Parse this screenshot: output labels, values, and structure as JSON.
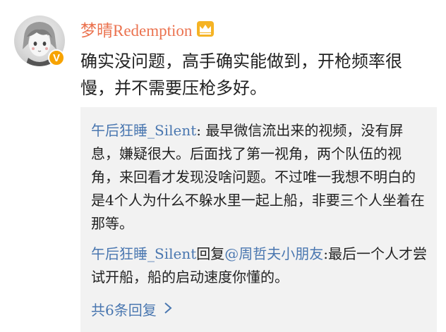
{
  "comment": {
    "username": "梦晴Redemption",
    "text": "确实没问题，高手确实能做到，开枪频率很慢，并不需要压枪多好。",
    "verified_icon": "v-verified-icon",
    "member_icon": "crown-icon"
  },
  "replies": [
    {
      "author": "午后狂睡_Silent",
      "separator": ": ",
      "text": "最早微信流出来的视频，没有屏息，嫌疑很大。后面找了第一视角，两个队伍的视角，来回看才发现没啥问题。不过唯一我想不明白的是4个人为什么不躲水里一起上船，非要三个人坐着在那等。"
    },
    {
      "author": "午后狂睡_Silent",
      "reply_word": "回复",
      "mention": "@周哲夫小朋友",
      "separator": ":",
      "text": "最后一个人才尝试开船，船的启动速度你懂的。"
    }
  ],
  "more_replies_label": "共6条回复",
  "colors": {
    "username": "#eb7350",
    "link": "#4a77b0",
    "reply_background": "#f2f2f2",
    "badge": "#f7a300"
  }
}
